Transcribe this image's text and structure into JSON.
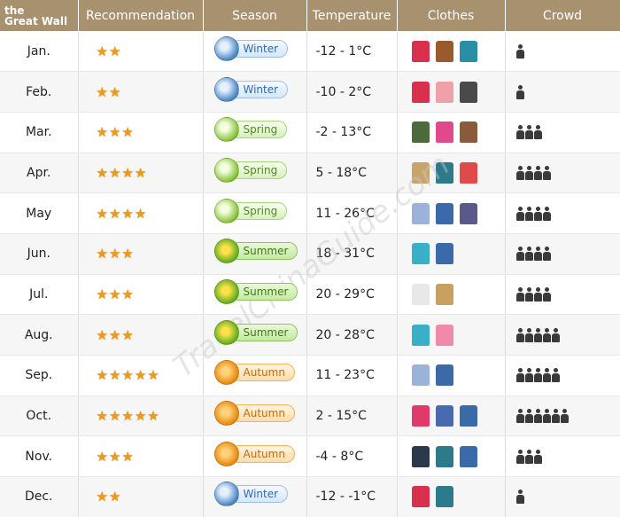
{
  "header": {
    "corner_line1": "the",
    "corner_line2": "Great Wall",
    "columns": [
      "Recommendation",
      "Season",
      "Temperature",
      "Clothes",
      "Crowd"
    ]
  },
  "watermark": "TravelChinaGuide.com",
  "season_colors": {
    "Winter": "#2c6cb0",
    "Spring": "#4f8d1e",
    "Summer": "#3e7b16",
    "Autumn": "#c86a07"
  },
  "rows": [
    {
      "month": "Jan.",
      "stars": 2,
      "season": "Winter",
      "temp": "-12 - 1°C",
      "clothes": [
        {
          "icon": "down-jacket-icon",
          "color": "#d8304d"
        },
        {
          "icon": "coat-icon",
          "color": "#9b5a2d"
        },
        {
          "icon": "knit-hat-icon",
          "color": "#2a8fa5"
        }
      ],
      "crowd": 1
    },
    {
      "month": "Feb.",
      "stars": 2,
      "season": "Winter",
      "temp": "-10 - 2°C",
      "clothes": [
        {
          "icon": "down-jacket-icon",
          "color": "#d8304d"
        },
        {
          "icon": "long-coat-icon",
          "color": "#f0a0a8"
        },
        {
          "icon": "boots-icon",
          "color": "#4a4a4a"
        }
      ],
      "crowd": 1
    },
    {
      "month": "Mar.",
      "stars": 3,
      "season": "Spring",
      "temp": "-2 - 13°C",
      "clothes": [
        {
          "icon": "jacket-icon",
          "color": "#4d6a3a"
        },
        {
          "icon": "hoodie-icon",
          "color": "#e04a8a"
        },
        {
          "icon": "shoes-icon",
          "color": "#8a5a3a"
        }
      ],
      "crowd": 3
    },
    {
      "month": "Apr.",
      "stars": 4,
      "season": "Spring",
      "temp": "5 - 18°C",
      "clothes": [
        {
          "icon": "trench-coat-icon",
          "color": "#c9a46a"
        },
        {
          "icon": "sweater-icon",
          "color": "#2d7a8a"
        },
        {
          "icon": "jacket-icon",
          "color": "#e04a4a"
        }
      ],
      "crowd": 4
    },
    {
      "month": "May",
      "stars": 4,
      "season": "Spring",
      "temp": "11 - 26°C",
      "clothes": [
        {
          "icon": "shirt-icon",
          "color": "#9bb3d8"
        },
        {
          "icon": "jeans-icon",
          "color": "#3a6aa8"
        },
        {
          "icon": "sneakers-icon",
          "color": "#5a5a8a"
        }
      ],
      "crowd": 4
    },
    {
      "month": "Jun.",
      "stars": 3,
      "season": "Summer",
      "temp": "18 - 31°C",
      "clothes": [
        {
          "icon": "t-shirt-icon",
          "color": "#3ab0c8"
        },
        {
          "icon": "jeans-icon",
          "color": "#3a6aa8"
        }
      ],
      "crowd": 4
    },
    {
      "month": "Jul.",
      "stars": 3,
      "season": "Summer",
      "temp": "20 - 29°C",
      "clothes": [
        {
          "icon": "shirt-icon",
          "color": "#e8e8e8"
        },
        {
          "icon": "shorts-icon",
          "color": "#c8a060"
        }
      ],
      "crowd": 4
    },
    {
      "month": "Aug.",
      "stars": 3,
      "season": "Summer",
      "temp": "20 - 28°C",
      "clothes": [
        {
          "icon": "t-shirt-icon",
          "color": "#3ab0c8"
        },
        {
          "icon": "sun-hat-icon",
          "color": "#f08aa8"
        }
      ],
      "crowd": 5
    },
    {
      "month": "Sep.",
      "stars": 5,
      "season": "Autumn",
      "temp": "11 - 23°C",
      "clothes": [
        {
          "icon": "shirt-icon",
          "color": "#9bb3d8"
        },
        {
          "icon": "jeans-icon",
          "color": "#3a6aa8"
        }
      ],
      "crowd": 5
    },
    {
      "month": "Oct.",
      "stars": 5,
      "season": "Autumn",
      "temp": "2 - 15°C",
      "clothes": [
        {
          "icon": "hoodie-icon",
          "color": "#e03a6a"
        },
        {
          "icon": "raglan-shirt-icon",
          "color": "#4a6ab0"
        },
        {
          "icon": "jeans-icon",
          "color": "#3a6aa8"
        }
      ],
      "crowd": 6
    },
    {
      "month": "Nov.",
      "stars": 3,
      "season": "Autumn",
      "temp": "-4 - 8°C",
      "clothes": [
        {
          "icon": "jacket-icon",
          "color": "#2a3a4a"
        },
        {
          "icon": "sweater-icon",
          "color": "#2d7a8a"
        },
        {
          "icon": "jeans-icon",
          "color": "#3a6aa8"
        }
      ],
      "crowd": 3
    },
    {
      "month": "Dec.",
      "stars": 2,
      "season": "Winter",
      "temp": "-12 - -1°C",
      "clothes": [
        {
          "icon": "down-jacket-icon",
          "color": "#d8304d"
        },
        {
          "icon": "sweater-icon",
          "color": "#2d7a8a"
        }
      ],
      "crowd": 1
    }
  ]
}
